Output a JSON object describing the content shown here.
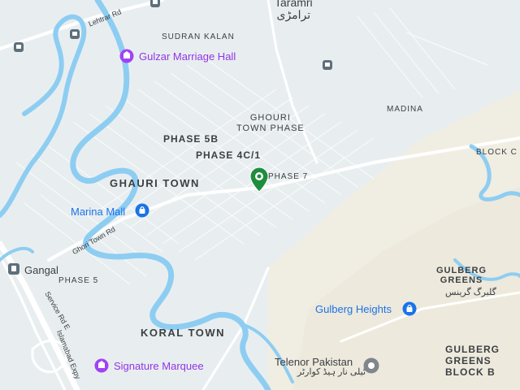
{
  "map": {
    "places": {
      "taramri_en": "Taramri",
      "taramri_ur": "ترامڑی",
      "sudran_kalan": "SUDRAN KALAN",
      "madina": "MADINA",
      "ghouri_town_phase_1": "GHOURI",
      "ghouri_town_phase_2": "TOWN PHASE",
      "phase_5b": "PHASE 5B",
      "phase_4c1": "PHASE 4C/1",
      "phase_7": "PHASE 7",
      "block_c": "BLOCK C",
      "ghauri_town": "GHAURI TOWN",
      "gangal": "Gangal",
      "phase_5": "PHASE 5",
      "gulberg_greens_1": "GULBERG",
      "gulberg_greens_2": "GREENS",
      "gulberg_greens_ur": "گلبرگ گرینس",
      "koral_town": "KORAL TOWN",
      "gulberg_greens_block_b_1": "GULBERG",
      "gulberg_greens_block_b_2": "GREENS",
      "gulberg_greens_block_b_3": "BLOCK B"
    },
    "roads": {
      "lehtrar_rd": "Lehtrar Rd",
      "ghori_town_rd": "Ghori Town Rd",
      "service_rd_e": "Service Rd E",
      "islamabad_expy": "Islamabad Expy"
    },
    "pois": {
      "gulzar_marriage_hall": "Gulzar Marriage Hall",
      "marina_mall": "Marina Mall",
      "gulberg_heights": "Gulberg Heights",
      "signature_marquee": "Signature Marquee",
      "telenor_pakistan": "Telenor Pakistan",
      "telenor_pakistan_ur": "ٹیلی نار ہیڈ کوارٹر"
    },
    "colors": {
      "water": "#8ecdf2",
      "land": "#e8eef0",
      "road": "#ffffff",
      "urban_sand": "#f0ede2",
      "pin": "#1e8e3e",
      "poi_purple": "#9334e6",
      "poi_blue": "#1a73e8"
    }
  }
}
